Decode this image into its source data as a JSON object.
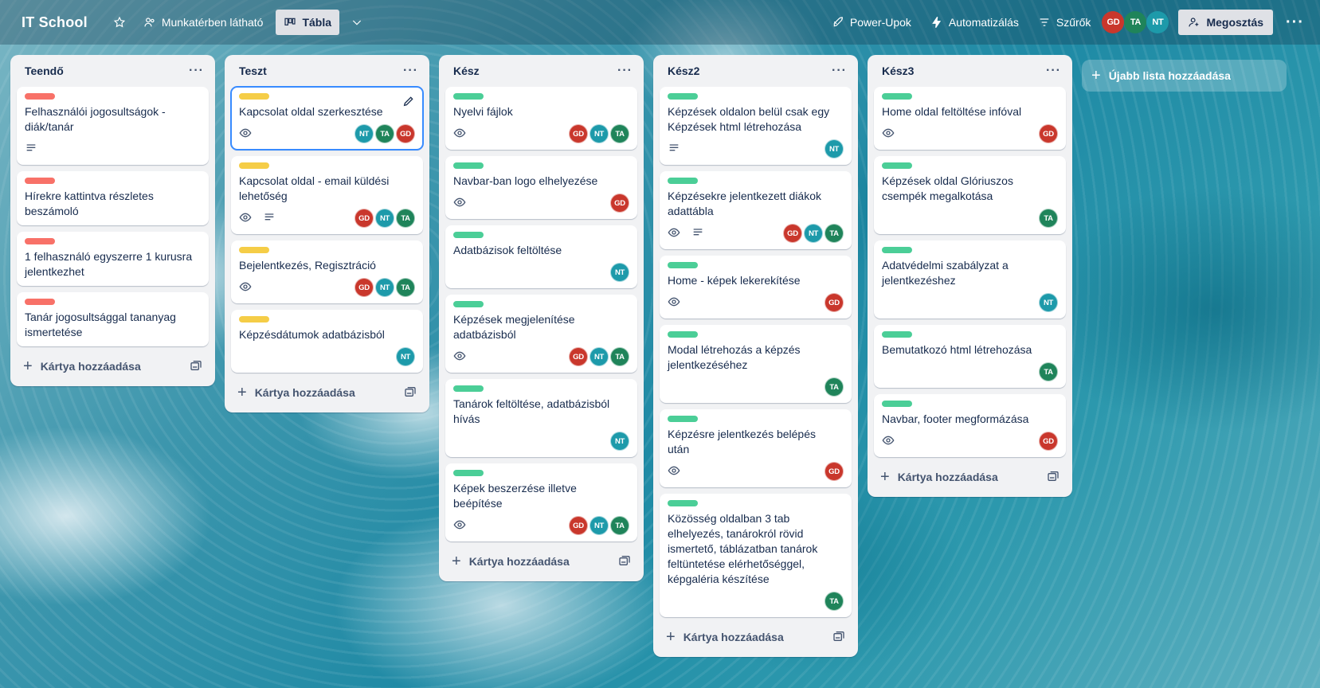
{
  "topbar": {
    "title": "IT School",
    "visibility": "Munkatérben látható",
    "view": "Tábla",
    "power_ups": "Power-Upok",
    "automation": "Automatizálás",
    "filters": "Szűrők",
    "share": "Megosztás",
    "members": [
      "GD",
      "TA",
      "NT"
    ]
  },
  "add_card_label": "Kártya hozzáadása",
  "add_list_label": "Újabb lista hozzáadása",
  "colors": {
    "red": "#f87168",
    "yellow": "#f5cd47",
    "green": "#4bce97",
    "GD": "#c9372c",
    "TA": "#1f845a",
    "NT": "#1d9aaa"
  },
  "lists": [
    {
      "title": "Teendő",
      "cards": [
        {
          "label": "red",
          "title": "Felhasználói jogosultságok - diák/tanár",
          "watch": false,
          "desc": true,
          "members": []
        },
        {
          "label": "red",
          "title": "Hírekre kattintva részletes beszámoló",
          "watch": false,
          "desc": false,
          "members": []
        },
        {
          "label": "red",
          "title": "1 felhasználó egyszerre 1 kurusra jelentkezhet",
          "watch": false,
          "desc": false,
          "members": []
        },
        {
          "label": "red",
          "title": "Tanár jogosultsággal tananyag ismertetése",
          "watch": false,
          "desc": false,
          "members": []
        }
      ]
    },
    {
      "title": "Teszt",
      "cards": [
        {
          "label": "yellow",
          "title": "Kapcsolat oldal szerkesztése",
          "watch": true,
          "desc": false,
          "members": [
            "NT",
            "TA",
            "GD"
          ],
          "selected": true
        },
        {
          "label": "yellow",
          "title": "Kapcsolat oldal - email küldési lehetőség",
          "watch": true,
          "desc": true,
          "members": [
            "GD",
            "NT",
            "TA"
          ]
        },
        {
          "label": "yellow",
          "title": "Bejelentkezés, Regisztráció",
          "watch": true,
          "desc": false,
          "members": [
            "GD",
            "NT",
            "TA"
          ]
        },
        {
          "label": "yellow",
          "title": "Képzésdátumok adatbázisból",
          "watch": false,
          "desc": false,
          "members": [
            "NT"
          ]
        }
      ]
    },
    {
      "title": "Kész",
      "cards": [
        {
          "label": "green",
          "title": "Nyelvi fájlok",
          "watch": true,
          "desc": false,
          "members": [
            "GD",
            "NT",
            "TA"
          ]
        },
        {
          "label": "green",
          "title": "Navbar-ban logo elhelyezése",
          "watch": true,
          "desc": false,
          "members": [
            "GD"
          ]
        },
        {
          "label": "green",
          "title": "Adatbázisok feltöltése",
          "watch": false,
          "desc": false,
          "members": [
            "NT"
          ]
        },
        {
          "label": "green",
          "title": "Képzések megjelenítése adatbázisból",
          "watch": true,
          "desc": false,
          "members": [
            "GD",
            "NT",
            "TA"
          ]
        },
        {
          "label": "green",
          "title": "Tanárok feltöltése, adatbázisból hívás",
          "watch": false,
          "desc": false,
          "members": [
            "NT"
          ]
        },
        {
          "label": "green",
          "title": "Képek beszerzése illetve beépítése",
          "watch": true,
          "desc": false,
          "members": [
            "GD",
            "NT",
            "TA"
          ]
        }
      ]
    },
    {
      "title": "Kész2",
      "cards": [
        {
          "label": "green",
          "title": "Képzések oldalon belül csak egy Képzések html létrehozása",
          "watch": false,
          "desc": true,
          "members": [
            "NT"
          ]
        },
        {
          "label": "green",
          "title": "Képzésekre jelentkezett diákok adattábla",
          "watch": true,
          "desc": true,
          "members": [
            "GD",
            "NT",
            "TA"
          ]
        },
        {
          "label": "green",
          "title": "Home - képek lekerekítése",
          "watch": true,
          "desc": false,
          "members": [
            "GD"
          ]
        },
        {
          "label": "green",
          "title": "Modal létrehozás a képzés jelentkezéséhez",
          "watch": false,
          "desc": false,
          "members": [
            "TA"
          ]
        },
        {
          "label": "green",
          "title": "Képzésre jelentkezés belépés után",
          "watch": true,
          "desc": false,
          "members": [
            "GD"
          ]
        },
        {
          "label": "green",
          "title": "Közösség oldalban 3 tab elhelyezés, tanárokról rövid ismertető, táblázatban tanárok feltüntetése elérhetőséggel, képgaléria készítése",
          "watch": false,
          "desc": false,
          "members": [
            "TA"
          ]
        }
      ]
    },
    {
      "title": "Kész3",
      "cards": [
        {
          "label": "green",
          "title": "Home oldal feltöltése infóval",
          "watch": true,
          "desc": false,
          "members": [
            "GD"
          ]
        },
        {
          "label": "green",
          "title": "Képzések oldal Glóriuszos csempék megalkotása",
          "watch": false,
          "desc": false,
          "members": [
            "TA"
          ]
        },
        {
          "label": "green",
          "title": "Adatvédelmi szabályzat a jelentkezéshez",
          "watch": false,
          "desc": false,
          "members": [
            "NT"
          ]
        },
        {
          "label": "green",
          "title": "Bemutatkozó html létrehozása",
          "watch": false,
          "desc": false,
          "members": [
            "TA"
          ]
        },
        {
          "label": "green",
          "title": "Navbar, footer megformázása",
          "watch": true,
          "desc": false,
          "members": [
            "GD"
          ]
        }
      ]
    }
  ]
}
